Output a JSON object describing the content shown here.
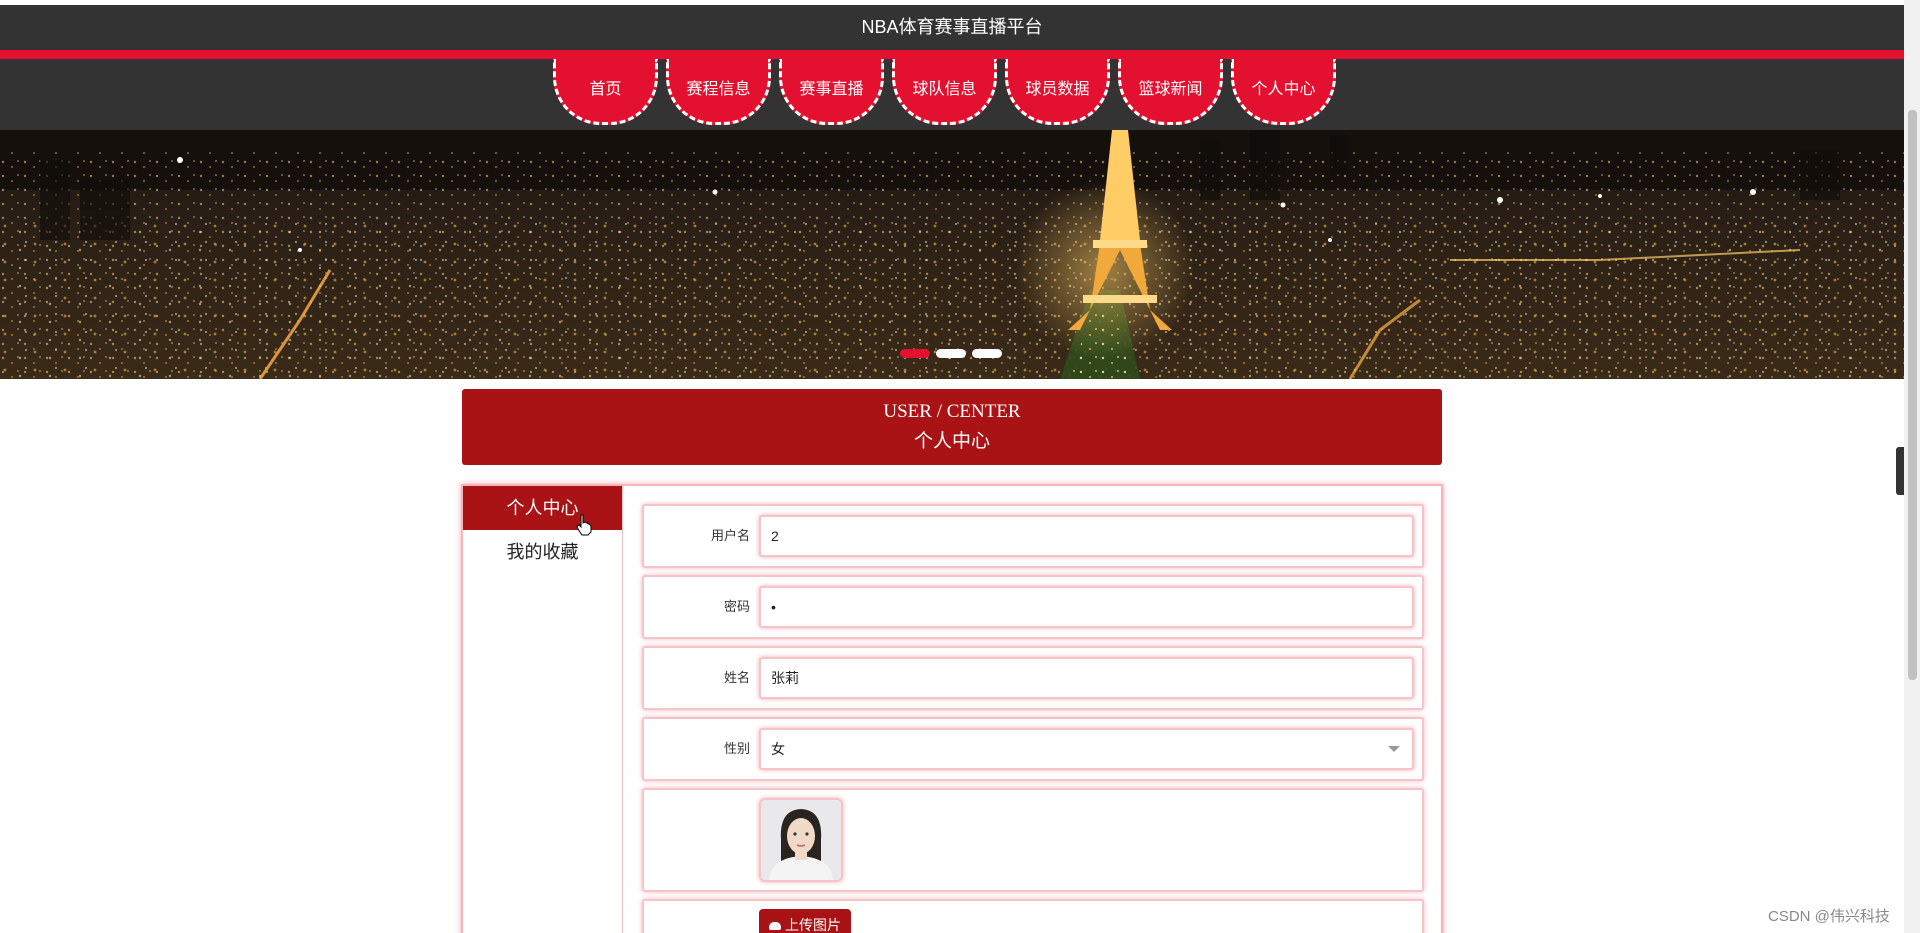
{
  "header": {
    "site_title": "NBA体育赛事直播平台"
  },
  "nav": {
    "items": [
      {
        "label": "首页"
      },
      {
        "label": "赛程信息"
      },
      {
        "label": "赛事直播"
      },
      {
        "label": "球队信息"
      },
      {
        "label": "球员数据"
      },
      {
        "label": "篮球新闻"
      },
      {
        "label": "个人中心"
      }
    ]
  },
  "banner": {
    "image_icon": "paris-night-eiffel-tower-icon",
    "slides_total": 3,
    "active_slide": 1
  },
  "section": {
    "title_en": "USER / CENTER",
    "title_cn": "个人中心"
  },
  "sidebar": {
    "items": [
      {
        "label": "个人中心",
        "active": true
      },
      {
        "label": "我的收藏",
        "active": false
      }
    ]
  },
  "form": {
    "username": {
      "label": "用户名",
      "value": "2"
    },
    "password": {
      "label": "密码",
      "value": "•"
    },
    "name": {
      "label": "姓名",
      "value": "张莉"
    },
    "gender": {
      "label": "性别",
      "value": "女"
    },
    "upload_label": "上传图片"
  },
  "colors": {
    "accent_red": "#e3112f",
    "dark_red": "#a91316",
    "header_dark": "#333333"
  },
  "watermark": "CSDN @伟兴科技"
}
